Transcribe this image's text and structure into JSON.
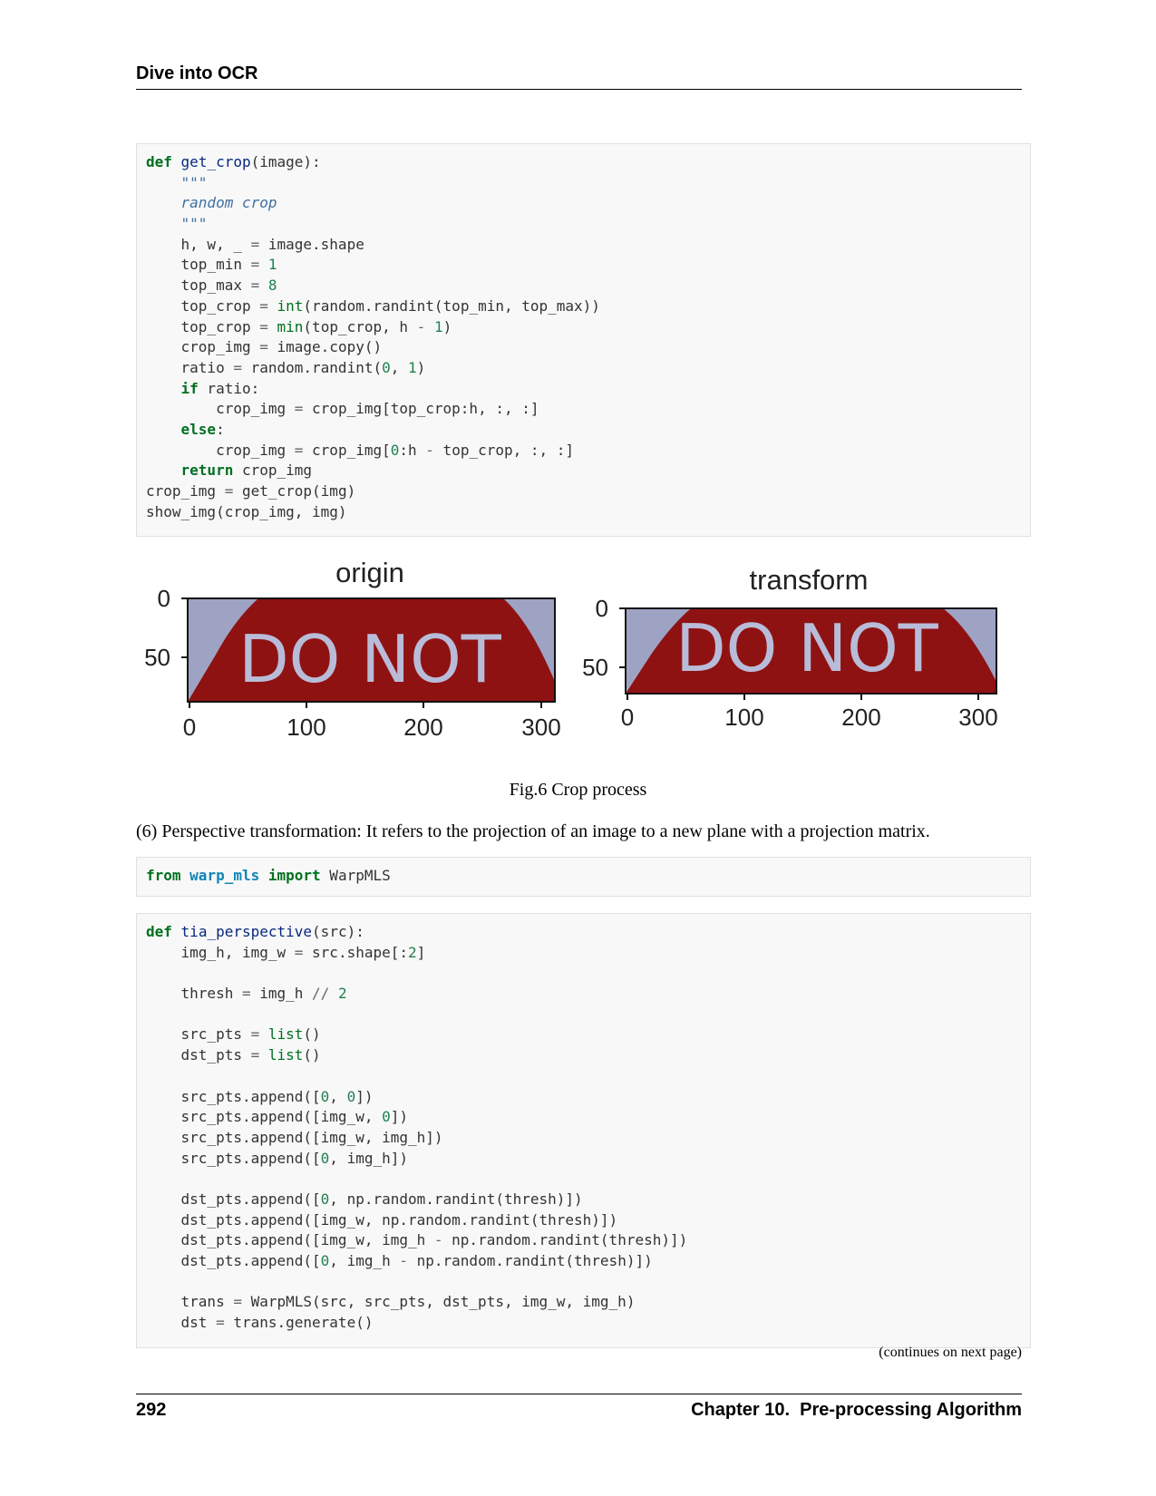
{
  "header": {
    "title": "Dive into OCR"
  },
  "code_blocks": [
    {
      "lines": [
        [
          [
            "kw",
            "def"
          ],
          [
            "p",
            " "
          ],
          [
            "fn",
            "get_crop"
          ],
          [
            "p",
            "(image):"
          ]
        ],
        [
          [
            "p",
            "    "
          ],
          [
            "str",
            "\"\"\""
          ]
        ],
        [
          [
            "p",
            "    "
          ],
          [
            "doc",
            "random crop"
          ]
        ],
        [
          [
            "p",
            "    "
          ],
          [
            "str",
            "\"\"\""
          ]
        ],
        [
          [
            "p",
            "    h, w, _ "
          ],
          [
            "op",
            "="
          ],
          [
            "p",
            " image.shape"
          ]
        ],
        [
          [
            "p",
            "    top_min "
          ],
          [
            "op",
            "="
          ],
          [
            "p",
            " "
          ],
          [
            "num",
            "1"
          ]
        ],
        [
          [
            "p",
            "    top_max "
          ],
          [
            "op",
            "="
          ],
          [
            "p",
            " "
          ],
          [
            "num",
            "8"
          ]
        ],
        [
          [
            "p",
            "    top_crop "
          ],
          [
            "op",
            "="
          ],
          [
            "p",
            " "
          ],
          [
            "bi",
            "int"
          ],
          [
            "p",
            "(random.randint(top_min, top_max))"
          ]
        ],
        [
          [
            "p",
            "    top_crop "
          ],
          [
            "op",
            "="
          ],
          [
            "p",
            " "
          ],
          [
            "bi",
            "min"
          ],
          [
            "p",
            "(top_crop, h "
          ],
          [
            "op",
            "-"
          ],
          [
            "p",
            " "
          ],
          [
            "num",
            "1"
          ],
          [
            "p",
            ")"
          ]
        ],
        [
          [
            "p",
            "    crop_img "
          ],
          [
            "op",
            "="
          ],
          [
            "p",
            " image.copy()"
          ]
        ],
        [
          [
            "p",
            "    ratio "
          ],
          [
            "op",
            "="
          ],
          [
            "p",
            " random.randint("
          ],
          [
            "num",
            "0"
          ],
          [
            "p",
            ", "
          ],
          [
            "num",
            "1"
          ],
          [
            "p",
            ")"
          ]
        ],
        [
          [
            "p",
            "    "
          ],
          [
            "kw",
            "if"
          ],
          [
            "p",
            " ratio:"
          ]
        ],
        [
          [
            "p",
            "        crop_img "
          ],
          [
            "op",
            "="
          ],
          [
            "p",
            " crop_img[top_crop:h, :, :]"
          ]
        ],
        [
          [
            "p",
            "    "
          ],
          [
            "kw",
            "else"
          ],
          [
            "p",
            ":"
          ]
        ],
        [
          [
            "p",
            "        crop_img "
          ],
          [
            "op",
            "="
          ],
          [
            "p",
            " crop_img["
          ],
          [
            "num",
            "0"
          ],
          [
            "p",
            ":h "
          ],
          [
            "op",
            "-"
          ],
          [
            "p",
            " top_crop, :, :]"
          ]
        ],
        [
          [
            "p",
            "    "
          ],
          [
            "kw",
            "return"
          ],
          [
            "p",
            " crop_img"
          ]
        ],
        [
          [
            "p",
            "crop_img "
          ],
          [
            "op",
            "="
          ],
          [
            "p",
            " get_crop(img)"
          ]
        ],
        [
          [
            "p",
            "show_img(crop_img, img)"
          ]
        ]
      ]
    },
    {
      "lines": [
        [
          [
            "kw",
            "from"
          ],
          [
            "p",
            " "
          ],
          [
            "ns",
            "warp_mls"
          ],
          [
            "p",
            " "
          ],
          [
            "kw",
            "import"
          ],
          [
            "p",
            " WarpMLS"
          ]
        ]
      ]
    },
    {
      "lines": [
        [
          [
            "kw",
            "def"
          ],
          [
            "p",
            " "
          ],
          [
            "fn",
            "tia_perspective"
          ],
          [
            "p",
            "(src):"
          ]
        ],
        [
          [
            "p",
            "    img_h, img_w "
          ],
          [
            "op",
            "="
          ],
          [
            "p",
            " src.shape[:"
          ],
          [
            "num",
            "2"
          ],
          [
            "p",
            "]"
          ]
        ],
        [
          [
            "p",
            ""
          ]
        ],
        [
          [
            "p",
            "    thresh "
          ],
          [
            "op",
            "="
          ],
          [
            "p",
            " img_h "
          ],
          [
            "op",
            "//"
          ],
          [
            "p",
            " "
          ],
          [
            "num",
            "2"
          ]
        ],
        [
          [
            "p",
            ""
          ]
        ],
        [
          [
            "p",
            "    src_pts "
          ],
          [
            "op",
            "="
          ],
          [
            "p",
            " "
          ],
          [
            "bi",
            "list"
          ],
          [
            "p",
            "()"
          ]
        ],
        [
          [
            "p",
            "    dst_pts "
          ],
          [
            "op",
            "="
          ],
          [
            "p",
            " "
          ],
          [
            "bi",
            "list"
          ],
          [
            "p",
            "()"
          ]
        ],
        [
          [
            "p",
            ""
          ]
        ],
        [
          [
            "p",
            "    src_pts.append(["
          ],
          [
            "num",
            "0"
          ],
          [
            "p",
            ", "
          ],
          [
            "num",
            "0"
          ],
          [
            "p",
            "])"
          ]
        ],
        [
          [
            "p",
            "    src_pts.append([img_w, "
          ],
          [
            "num",
            "0"
          ],
          [
            "p",
            "])"
          ]
        ],
        [
          [
            "p",
            "    src_pts.append([img_w, img_h])"
          ]
        ],
        [
          [
            "p",
            "    src_pts.append(["
          ],
          [
            "num",
            "0"
          ],
          [
            "p",
            ", img_h])"
          ]
        ],
        [
          [
            "p",
            ""
          ]
        ],
        [
          [
            "p",
            "    dst_pts.append(["
          ],
          [
            "num",
            "0"
          ],
          [
            "p",
            ", np.random.randint(thresh)])"
          ]
        ],
        [
          [
            "p",
            "    dst_pts.append([img_w, np.random.randint(thresh)])"
          ]
        ],
        [
          [
            "p",
            "    dst_pts.append([img_w, img_h "
          ],
          [
            "op",
            "-"
          ],
          [
            "p",
            " np.random.randint(thresh)])"
          ]
        ],
        [
          [
            "p",
            "    dst_pts.append(["
          ],
          [
            "num",
            "0"
          ],
          [
            "p",
            ", img_h "
          ],
          [
            "op",
            "-"
          ],
          [
            "p",
            " np.random.randint(thresh)])"
          ]
        ],
        [
          [
            "p",
            ""
          ]
        ],
        [
          [
            "p",
            "    trans "
          ],
          [
            "op",
            "="
          ],
          [
            "p",
            " WarpMLS(src, src_pts, dst_pts, img_w, img_h)"
          ]
        ],
        [
          [
            "p",
            "    dst "
          ],
          [
            "op",
            "="
          ],
          [
            "p",
            " trans.generate()"
          ]
        ]
      ]
    }
  ],
  "figure": {
    "panels": [
      {
        "title": "origin",
        "y_ticks": [
          "0",
          "50"
        ],
        "x_ticks": [
          "0",
          "100",
          "200",
          "300"
        ],
        "sign_text": "DO NOT"
      },
      {
        "title": "transform",
        "y_ticks": [
          "0",
          "50"
        ],
        "x_ticks": [
          "0",
          "100",
          "200",
          "300"
        ],
        "sign_text": "DO NOT"
      }
    ],
    "colors": {
      "sign_red": "#8f1212",
      "background_lavender": "#9ea3c4",
      "text_lavender": "#b8bcd8"
    }
  },
  "caption": "Fig.6 Crop process",
  "paragraph": "(6) Perspective transformation: It refers to the projection of an image to a new plane with a projection matrix.",
  "continues": "(continues on next page)",
  "footer": {
    "page_number": "292",
    "chapter": "Chapter 10.  Pre-processing Algorithm"
  }
}
